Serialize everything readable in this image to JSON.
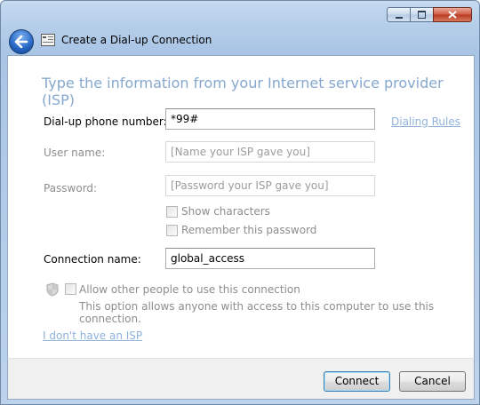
{
  "window": {
    "title": "Create a Dial-up Connection"
  },
  "header": {
    "text": "Type the information from your Internet service provider (ISP)"
  },
  "form": {
    "phone": {
      "label": "Dial-up phone number:",
      "value": "*99#"
    },
    "dialing_rules": "Dialing Rules",
    "username": {
      "label": "User name:",
      "placeholder": "[Name your ISP gave you]"
    },
    "password": {
      "label": "Password:",
      "placeholder": "[Password your ISP gave you]"
    },
    "show_characters": "Show characters",
    "remember_password": "Remember this password",
    "connection_name": {
      "label": "Connection name:",
      "value": "global_access"
    },
    "allow_others": "Allow other people to use this connection",
    "allow_others_desc": "This option allows anyone with access to this computer to use this connection.",
    "no_isp": "I don't have an ISP"
  },
  "footer": {
    "connect": "Connect",
    "cancel": "Cancel"
  },
  "icons": {
    "minimize": "minimize-icon",
    "maximize": "maximize-icon",
    "close": "close-icon",
    "back": "back-arrow-icon",
    "wizard": "dialup-connection-icon",
    "shield": "uac-shield-icon"
  }
}
